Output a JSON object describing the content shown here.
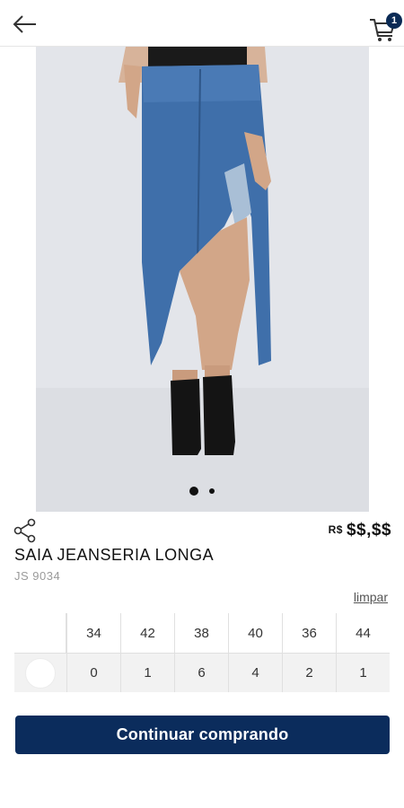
{
  "header": {
    "back_icon": "arrow-left-icon",
    "cart_icon": "cart-icon",
    "cart_count": "1"
  },
  "gallery": {
    "image_subject": "long asymmetric distressed denim skirt with black ankle boots",
    "page_count": 2,
    "active_index": 0
  },
  "product": {
    "share_icon": "share-icon",
    "price_currency": "R$",
    "price_value": "$$,$$",
    "name": "SAIA JEANSERIA LONGA",
    "sku": "JS 9034"
  },
  "size_table": {
    "clear_label": "limpar",
    "sizes": [
      "34",
      "42",
      "38",
      "40",
      "36",
      "44"
    ],
    "quantities": [
      "0",
      "1",
      "6",
      "4",
      "2",
      "1"
    ],
    "color_swatch": "#ffffff"
  },
  "actions": {
    "continue_label": "Continuar comprando"
  },
  "colors": {
    "primary": "#0b2c5c",
    "badge": "#0a2a55"
  }
}
